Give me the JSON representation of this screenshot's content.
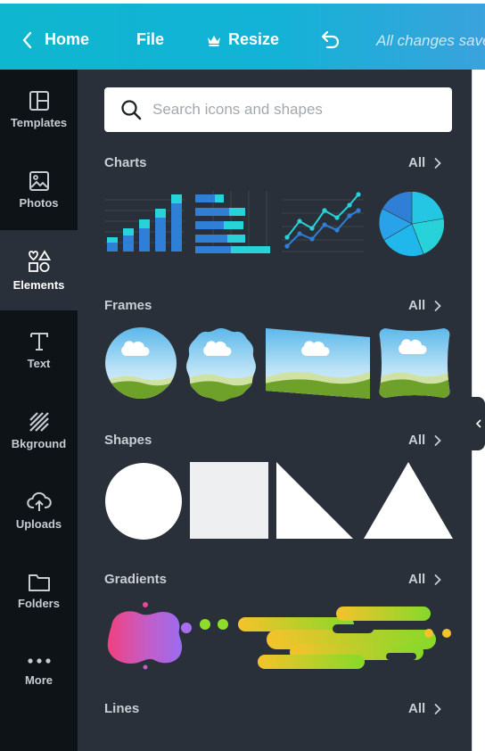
{
  "topbar": {
    "home_label": "Home",
    "file_label": "File",
    "resize_label": "Resize",
    "status_text": "All changes saved"
  },
  "sidebar": {
    "items": [
      {
        "label": "Templates",
        "icon": "layout-icon"
      },
      {
        "label": "Photos",
        "icon": "image-icon"
      },
      {
        "label": "Elements",
        "icon": "shapes-icon",
        "active": true
      },
      {
        "label": "Text",
        "icon": "text-icon"
      },
      {
        "label": "Bkground",
        "icon": "stripes-icon"
      },
      {
        "label": "Uploads",
        "icon": "cloud-upload-icon"
      },
      {
        "label": "Folders",
        "icon": "folder-icon"
      },
      {
        "label": "More",
        "icon": "more-dots-icon"
      }
    ]
  },
  "search": {
    "placeholder": "Search icons and shapes"
  },
  "sections": [
    {
      "title": "Charts",
      "all_label": "All",
      "thumbs": [
        "bar-chart",
        "horizontal-bar-chart",
        "line-chart",
        "pie-chart"
      ]
    },
    {
      "title": "Frames",
      "all_label": "All",
      "thumbs": [
        "circle-frame",
        "scalloped-frame",
        "skewed-frame",
        "rounded-frame"
      ]
    },
    {
      "title": "Shapes",
      "all_label": "All",
      "thumbs": [
        "circle",
        "square",
        "right-triangle",
        "triangle"
      ]
    },
    {
      "title": "Gradients",
      "all_label": "All",
      "thumbs": [
        "pink-purple-blob",
        "yellow-green-streaks"
      ]
    },
    {
      "title": "Lines",
      "all_label": "All"
    }
  ],
  "colors": {
    "topbar_start": "#0fb6cf",
    "topbar_end": "#3aa2dc",
    "sidebar_bg": "#0e1318",
    "panel_bg": "#293039",
    "chart_blue": "#2f7fd6",
    "chart_teal": "#27d3d8",
    "chart_green": "#2ad59b"
  }
}
